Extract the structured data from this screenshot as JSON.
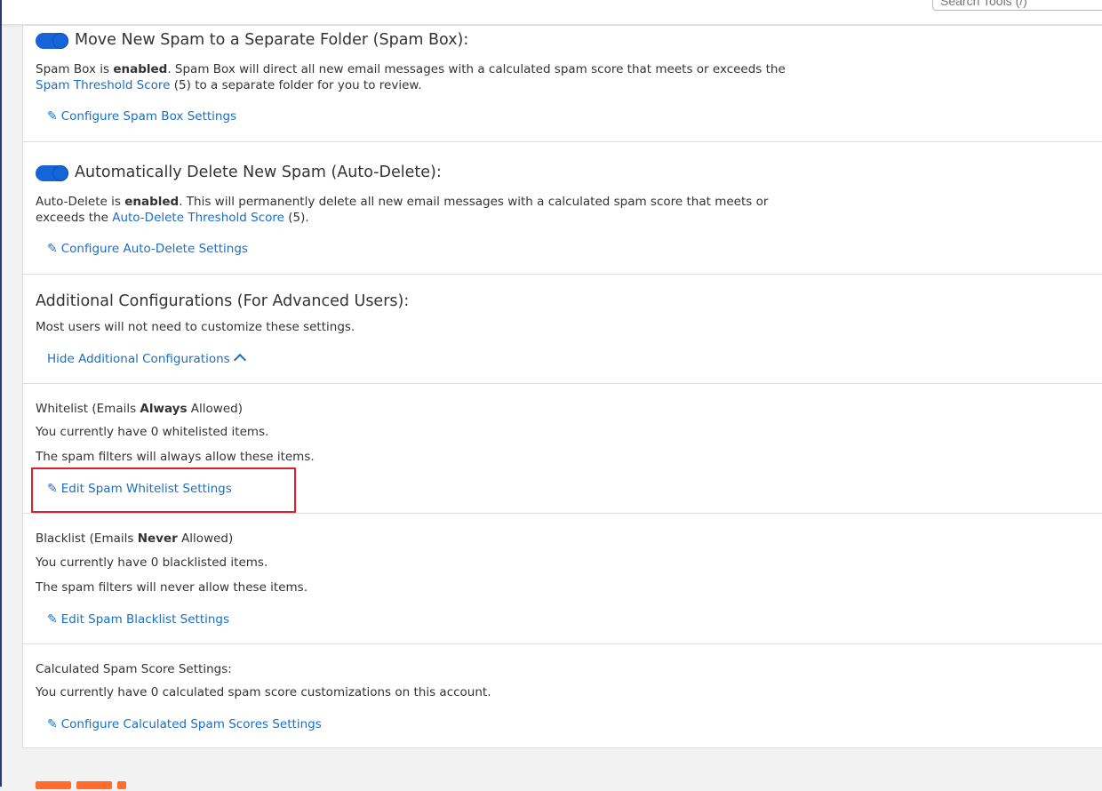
{
  "search": {
    "placeholder": "Search Tools (/)"
  },
  "spam_box": {
    "title": "Move New Spam to a Separate Folder (Spam Box):",
    "text_before": "Spam Box is ",
    "status": "enabled",
    "text_after": ". Spam Box will direct all new email messages with a calculated spam score that meets or exceeds the ",
    "link": "Spam Threshold Score",
    "text_end": " (5) to a separate folder for you to review.",
    "action": "Configure Spam Box Settings"
  },
  "auto_delete": {
    "title": "Automatically Delete New Spam (Auto-Delete):",
    "text_before": "Auto-Delete is ",
    "status": "enabled",
    "text_after": ". This will permanently delete all new email messages with a calculated spam score that meets or exceeds the ",
    "link": "Auto-Delete Threshold Score",
    "text_end": " (5).",
    "action": "Configure Auto-Delete Settings"
  },
  "additional": {
    "title": "Additional Configurations (For Advanced Users):",
    "description": "Most users will not need to customize these settings.",
    "action": "Hide Additional Configurations"
  },
  "whitelist": {
    "label_before": "Whitelist (Emails ",
    "label_bold": "Always",
    "label_after": " Allowed)",
    "count_text": "You currently have 0 whitelisted items.",
    "description": "The spam filters will always allow these items.",
    "action": "Edit Spam Whitelist Settings"
  },
  "blacklist": {
    "label_before": "Blacklist (Emails ",
    "label_bold": "Never",
    "label_after": " Allowed)",
    "count_text": "You currently have 0 blacklisted items.",
    "description": "The spam filters will never allow these items.",
    "action": "Edit Spam Blacklist Settings"
  },
  "spam_scores": {
    "label": "Calculated Spam Score Settings:",
    "count_text": "You currently have 0 calculated spam score customizations on this account.",
    "action": "Configure Calculated Spam Scores Settings"
  },
  "colors": {
    "accent": "#1a6fc4",
    "toggle": "#1565d8",
    "highlight": "#d9202c"
  },
  "icons": {
    "edit": "pencil-icon",
    "collapse": "chevron-up-icon"
  }
}
